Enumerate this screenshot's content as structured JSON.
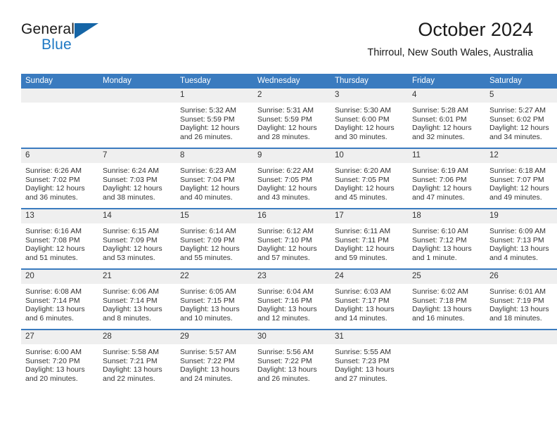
{
  "brand": {
    "name_part1": "General",
    "name_part2": "Blue",
    "triangle_color": "#1565a6",
    "blue_text_color": "#1c77c3"
  },
  "header": {
    "title": "October 2024",
    "subtitle": "Thirroul, New South Wales, Australia"
  },
  "theme": {
    "header_blue": "#3a7bbf",
    "daynum_gray": "#efefef",
    "text": "#333333"
  },
  "weekday_headers": [
    "Sunday",
    "Monday",
    "Tuesday",
    "Wednesday",
    "Thursday",
    "Friday",
    "Saturday"
  ],
  "labels": {
    "sunrise_prefix": "Sunrise: ",
    "sunset_prefix": "Sunset: ",
    "daylight_prefix": "Daylight: "
  },
  "weeks": [
    [
      {
        "day": "",
        "blank": true,
        "sunrise": "",
        "sunset": "",
        "daylight": ""
      },
      {
        "day": "",
        "blank": true,
        "sunrise": "",
        "sunset": "",
        "daylight": ""
      },
      {
        "day": "1",
        "sunrise": "Sunrise: 5:32 AM",
        "sunset": "Sunset: 5:59 PM",
        "daylight": "Daylight: 12 hours and 26 minutes."
      },
      {
        "day": "2",
        "sunrise": "Sunrise: 5:31 AM",
        "sunset": "Sunset: 5:59 PM",
        "daylight": "Daylight: 12 hours and 28 minutes."
      },
      {
        "day": "3",
        "sunrise": "Sunrise: 5:30 AM",
        "sunset": "Sunset: 6:00 PM",
        "daylight": "Daylight: 12 hours and 30 minutes."
      },
      {
        "day": "4",
        "sunrise": "Sunrise: 5:28 AM",
        "sunset": "Sunset: 6:01 PM",
        "daylight": "Daylight: 12 hours and 32 minutes."
      },
      {
        "day": "5",
        "sunrise": "Sunrise: 5:27 AM",
        "sunset": "Sunset: 6:02 PM",
        "daylight": "Daylight: 12 hours and 34 minutes."
      }
    ],
    [
      {
        "day": "6",
        "sunrise": "Sunrise: 6:26 AM",
        "sunset": "Sunset: 7:02 PM",
        "daylight": "Daylight: 12 hours and 36 minutes."
      },
      {
        "day": "7",
        "sunrise": "Sunrise: 6:24 AM",
        "sunset": "Sunset: 7:03 PM",
        "daylight": "Daylight: 12 hours and 38 minutes."
      },
      {
        "day": "8",
        "sunrise": "Sunrise: 6:23 AM",
        "sunset": "Sunset: 7:04 PM",
        "daylight": "Daylight: 12 hours and 40 minutes."
      },
      {
        "day": "9",
        "sunrise": "Sunrise: 6:22 AM",
        "sunset": "Sunset: 7:05 PM",
        "daylight": "Daylight: 12 hours and 43 minutes."
      },
      {
        "day": "10",
        "sunrise": "Sunrise: 6:20 AM",
        "sunset": "Sunset: 7:05 PM",
        "daylight": "Daylight: 12 hours and 45 minutes."
      },
      {
        "day": "11",
        "sunrise": "Sunrise: 6:19 AM",
        "sunset": "Sunset: 7:06 PM",
        "daylight": "Daylight: 12 hours and 47 minutes."
      },
      {
        "day": "12",
        "sunrise": "Sunrise: 6:18 AM",
        "sunset": "Sunset: 7:07 PM",
        "daylight": "Daylight: 12 hours and 49 minutes."
      }
    ],
    [
      {
        "day": "13",
        "sunrise": "Sunrise: 6:16 AM",
        "sunset": "Sunset: 7:08 PM",
        "daylight": "Daylight: 12 hours and 51 minutes."
      },
      {
        "day": "14",
        "sunrise": "Sunrise: 6:15 AM",
        "sunset": "Sunset: 7:09 PM",
        "daylight": "Daylight: 12 hours and 53 minutes."
      },
      {
        "day": "15",
        "sunrise": "Sunrise: 6:14 AM",
        "sunset": "Sunset: 7:09 PM",
        "daylight": "Daylight: 12 hours and 55 minutes."
      },
      {
        "day": "16",
        "sunrise": "Sunrise: 6:12 AM",
        "sunset": "Sunset: 7:10 PM",
        "daylight": "Daylight: 12 hours and 57 minutes."
      },
      {
        "day": "17",
        "sunrise": "Sunrise: 6:11 AM",
        "sunset": "Sunset: 7:11 PM",
        "daylight": "Daylight: 12 hours and 59 minutes."
      },
      {
        "day": "18",
        "sunrise": "Sunrise: 6:10 AM",
        "sunset": "Sunset: 7:12 PM",
        "daylight": "Daylight: 13 hours and 1 minute."
      },
      {
        "day": "19",
        "sunrise": "Sunrise: 6:09 AM",
        "sunset": "Sunset: 7:13 PM",
        "daylight": "Daylight: 13 hours and 4 minutes."
      }
    ],
    [
      {
        "day": "20",
        "sunrise": "Sunrise: 6:08 AM",
        "sunset": "Sunset: 7:14 PM",
        "daylight": "Daylight: 13 hours and 6 minutes."
      },
      {
        "day": "21",
        "sunrise": "Sunrise: 6:06 AM",
        "sunset": "Sunset: 7:14 PM",
        "daylight": "Daylight: 13 hours and 8 minutes."
      },
      {
        "day": "22",
        "sunrise": "Sunrise: 6:05 AM",
        "sunset": "Sunset: 7:15 PM",
        "daylight": "Daylight: 13 hours and 10 minutes."
      },
      {
        "day": "23",
        "sunrise": "Sunrise: 6:04 AM",
        "sunset": "Sunset: 7:16 PM",
        "daylight": "Daylight: 13 hours and 12 minutes."
      },
      {
        "day": "24",
        "sunrise": "Sunrise: 6:03 AM",
        "sunset": "Sunset: 7:17 PM",
        "daylight": "Daylight: 13 hours and 14 minutes."
      },
      {
        "day": "25",
        "sunrise": "Sunrise: 6:02 AM",
        "sunset": "Sunset: 7:18 PM",
        "daylight": "Daylight: 13 hours and 16 minutes."
      },
      {
        "day": "26",
        "sunrise": "Sunrise: 6:01 AM",
        "sunset": "Sunset: 7:19 PM",
        "daylight": "Daylight: 13 hours and 18 minutes."
      }
    ],
    [
      {
        "day": "27",
        "sunrise": "Sunrise: 6:00 AM",
        "sunset": "Sunset: 7:20 PM",
        "daylight": "Daylight: 13 hours and 20 minutes."
      },
      {
        "day": "28",
        "sunrise": "Sunrise: 5:58 AM",
        "sunset": "Sunset: 7:21 PM",
        "daylight": "Daylight: 13 hours and 22 minutes."
      },
      {
        "day": "29",
        "sunrise": "Sunrise: 5:57 AM",
        "sunset": "Sunset: 7:22 PM",
        "daylight": "Daylight: 13 hours and 24 minutes."
      },
      {
        "day": "30",
        "sunrise": "Sunrise: 5:56 AM",
        "sunset": "Sunset: 7:22 PM",
        "daylight": "Daylight: 13 hours and 26 minutes."
      },
      {
        "day": "31",
        "sunrise": "Sunrise: 5:55 AM",
        "sunset": "Sunset: 7:23 PM",
        "daylight": "Daylight: 13 hours and 27 minutes."
      },
      {
        "day": "",
        "blank": true,
        "sunrise": "",
        "sunset": "",
        "daylight": ""
      },
      {
        "day": "",
        "blank": true,
        "sunrise": "",
        "sunset": "",
        "daylight": ""
      }
    ]
  ]
}
